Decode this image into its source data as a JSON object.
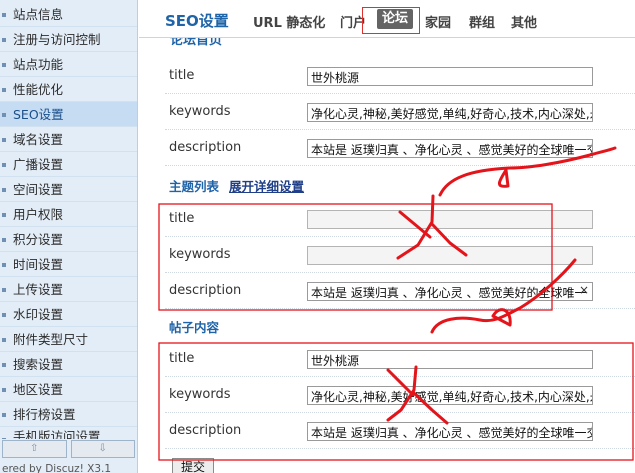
{
  "sidebar": {
    "items": [
      {
        "label": "站点信息"
      },
      {
        "label": "注册与访问控制"
      },
      {
        "label": "站点功能"
      },
      {
        "label": "性能优化"
      },
      {
        "label": "SEO设置",
        "active": true
      },
      {
        "label": "域名设置"
      },
      {
        "label": "广播设置"
      },
      {
        "label": "空间设置"
      },
      {
        "label": "用户权限"
      },
      {
        "label": "积分设置"
      },
      {
        "label": "时间设置"
      },
      {
        "label": "上传设置"
      },
      {
        "label": "水印设置"
      },
      {
        "label": "附件类型尺寸"
      },
      {
        "label": "搜索设置"
      },
      {
        "label": "地区设置"
      },
      {
        "label": "排行榜设置"
      },
      {
        "label": "手机版访问设置"
      }
    ],
    "scroll_up": "⇧",
    "scroll_down": "⇩",
    "powered": "ered by Discuz! X3.1"
  },
  "header": {
    "title": "SEO设置",
    "tabs": [
      "URL 静态化",
      "门户",
      "论坛",
      "家园",
      "群组",
      "其他"
    ],
    "active_tab": "论坛"
  },
  "sections": {
    "forum": {
      "title": "论坛首页",
      "rows": [
        {
          "label": "title",
          "value": "世外桃源"
        },
        {
          "label": "keywords",
          "value": "净化心灵,神秘,美好感觉,单纯,好奇心,技术,内心深处,永"
        },
        {
          "label": "description",
          "value": "本站是 返璞归真 、净化心灵 、感觉美好的全球唯一交"
        }
      ]
    },
    "thread_list": {
      "title": "主题列表",
      "link": "展开详细设置",
      "rows": [
        {
          "label": "title",
          "value": ""
        },
        {
          "label": "keywords",
          "value": ""
        },
        {
          "label": "description",
          "value": "本站是 返璞归真 、净化心灵 、感觉美好的全球唯一",
          "clear": "×"
        }
      ]
    },
    "post_content": {
      "title": "帖子内容",
      "rows": [
        {
          "label": "title",
          "value": "世外桃源"
        },
        {
          "label": "keywords",
          "value": "净化心灵,神秘,美好感觉,单纯,好奇心,技术,内心深处,永"
        },
        {
          "label": "description",
          "value": "本站是 返璞归真 、净化心灵 、感觉美好的全球唯一交"
        }
      ]
    }
  },
  "submit_label": "提交",
  "annotation_colors": {
    "ink": "#e4141b"
  }
}
